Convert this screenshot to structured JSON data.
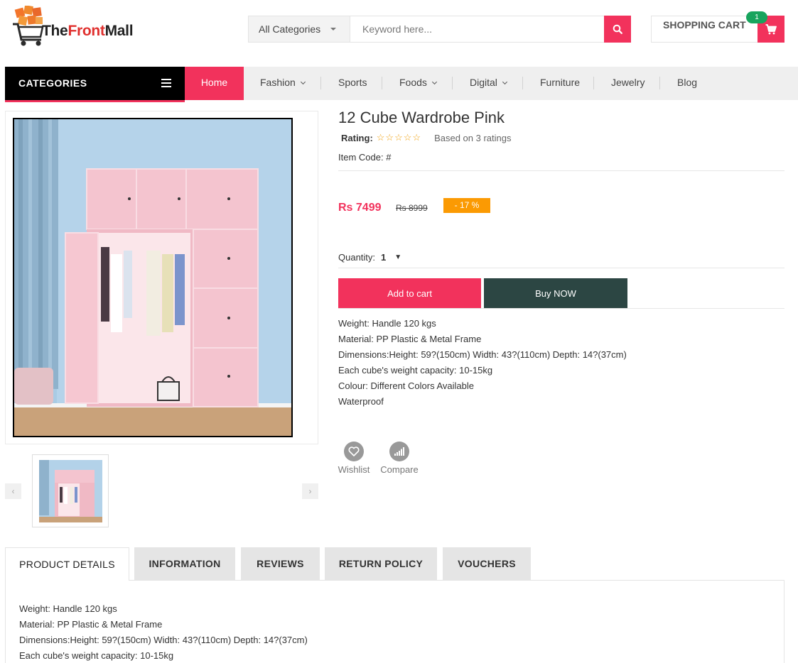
{
  "brand": {
    "name_part1": "The",
    "name_part2": "Front",
    "name_part3": "Mall",
    "colors": {
      "accent": "#f2325c",
      "dark": "#2c4643",
      "badge": "#fb9a03",
      "cart_count_bg": "#18a45d"
    }
  },
  "header": {
    "category_select": "All Categories",
    "search_placeholder": "Keyword here...",
    "cart_label": "SHOPPING CART",
    "cart_count": "1"
  },
  "nav": {
    "categories_label": "CATEGORIES",
    "items": [
      {
        "label": "Home"
      },
      {
        "label": "Fashion"
      },
      {
        "label": "Sports"
      },
      {
        "label": "Foods"
      },
      {
        "label": "Digital"
      },
      {
        "label": "Furniture"
      },
      {
        "label": "Jewelry"
      },
      {
        "label": "Blog"
      }
    ]
  },
  "product": {
    "title": "12 Cube Wardrobe Pink",
    "rating_label": "Rating:",
    "rating_stars": "☆☆☆☆☆",
    "rating_count": "Based on 3 ratings",
    "item_code": "Item Code: #",
    "price": "Rs 7499",
    "old_price": "Rs 8999",
    "discount": "- 17 %",
    "quantity_label": "Quantity:",
    "quantity_value": "1",
    "quantity_caret": "▼",
    "add_to_cart": "Add to cart",
    "buy_now": "Buy NOW",
    "specs": [
      "Weight: Handle 120 kgs",
      "Material: PP Plastic & Metal Frame",
      "Dimensions:Height: 59?(150cm) Width: 43?(110cm) Depth: 14?(37cm)",
      "Each cube's weight capacity: 10-15kg",
      "Colour: Different Colors Available",
      "Waterproof"
    ],
    "wishlist_label": "Wishlist",
    "compare_label": "Compare"
  },
  "gallery": {
    "prev_arrow": "‹",
    "next_arrow": "›"
  },
  "tabs": [
    {
      "label": "PRODUCT DETAILS"
    },
    {
      "label": "INFORMATION"
    },
    {
      "label": "REVIEWS"
    },
    {
      "label": "RETURN POLICY"
    },
    {
      "label": "VOUCHERS"
    }
  ],
  "tab_content": [
    "Weight: Handle 120 kgs",
    "Material: PP Plastic & Metal Frame",
    "Dimensions:Height: 59?(150cm) Width: 43?(110cm) Depth: 14?(37cm)",
    "Each cube's weight capacity: 10-15kg"
  ]
}
